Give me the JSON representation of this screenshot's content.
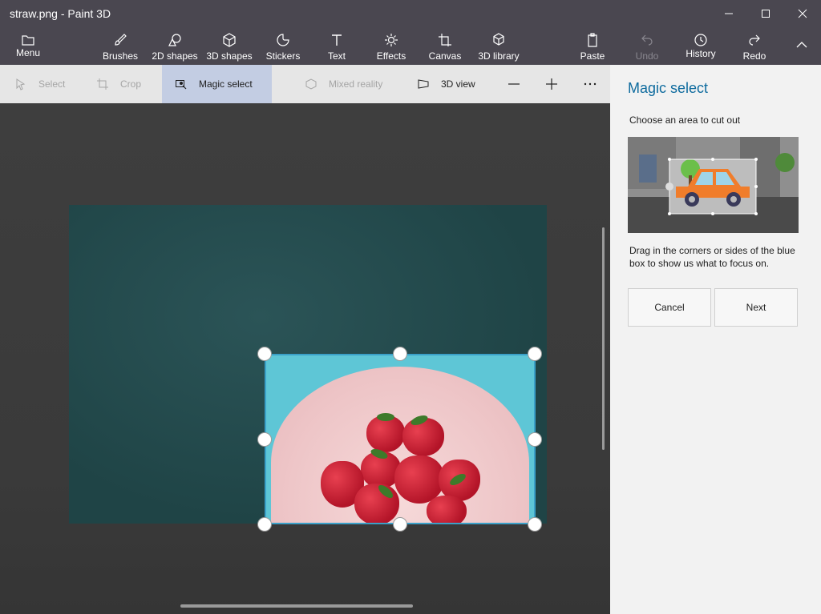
{
  "window": {
    "title": "straw.png - Paint 3D"
  },
  "ribbon": {
    "menu": "Menu",
    "items": [
      "Brushes",
      "2D shapes",
      "3D shapes",
      "Stickers",
      "Text",
      "Effects",
      "Canvas",
      "3D library"
    ],
    "right": {
      "paste": "Paste",
      "undo": "Undo",
      "history": "History",
      "redo": "Redo"
    }
  },
  "toolbar": {
    "select": "Select",
    "crop": "Crop",
    "magic_select": "Magic select",
    "mixed_reality": "Mixed reality",
    "view3d": "3D view",
    "zoom_out": "—",
    "zoom_in": "+",
    "more": "···"
  },
  "panel": {
    "title": "Magic select",
    "subtitle": "Choose an area to cut out",
    "help": "Drag in the corners or sides of the blue box to show us what to focus on.",
    "cancel": "Cancel",
    "next": "Next"
  },
  "colors": {
    "accent": "#0e6b9e",
    "chrome": "#4a4750",
    "selection_border": "#3aa0c8",
    "active_tool": "#c3cde3"
  },
  "icons": [
    "folder-icon",
    "brush-icon",
    "2d-shapes-icon",
    "3d-shapes-icon",
    "stickers-icon",
    "text-icon",
    "effects-icon",
    "canvas-icon",
    "3d-library-icon",
    "paste-icon",
    "undo-icon",
    "history-icon",
    "redo-icon",
    "collapse-icon"
  ]
}
